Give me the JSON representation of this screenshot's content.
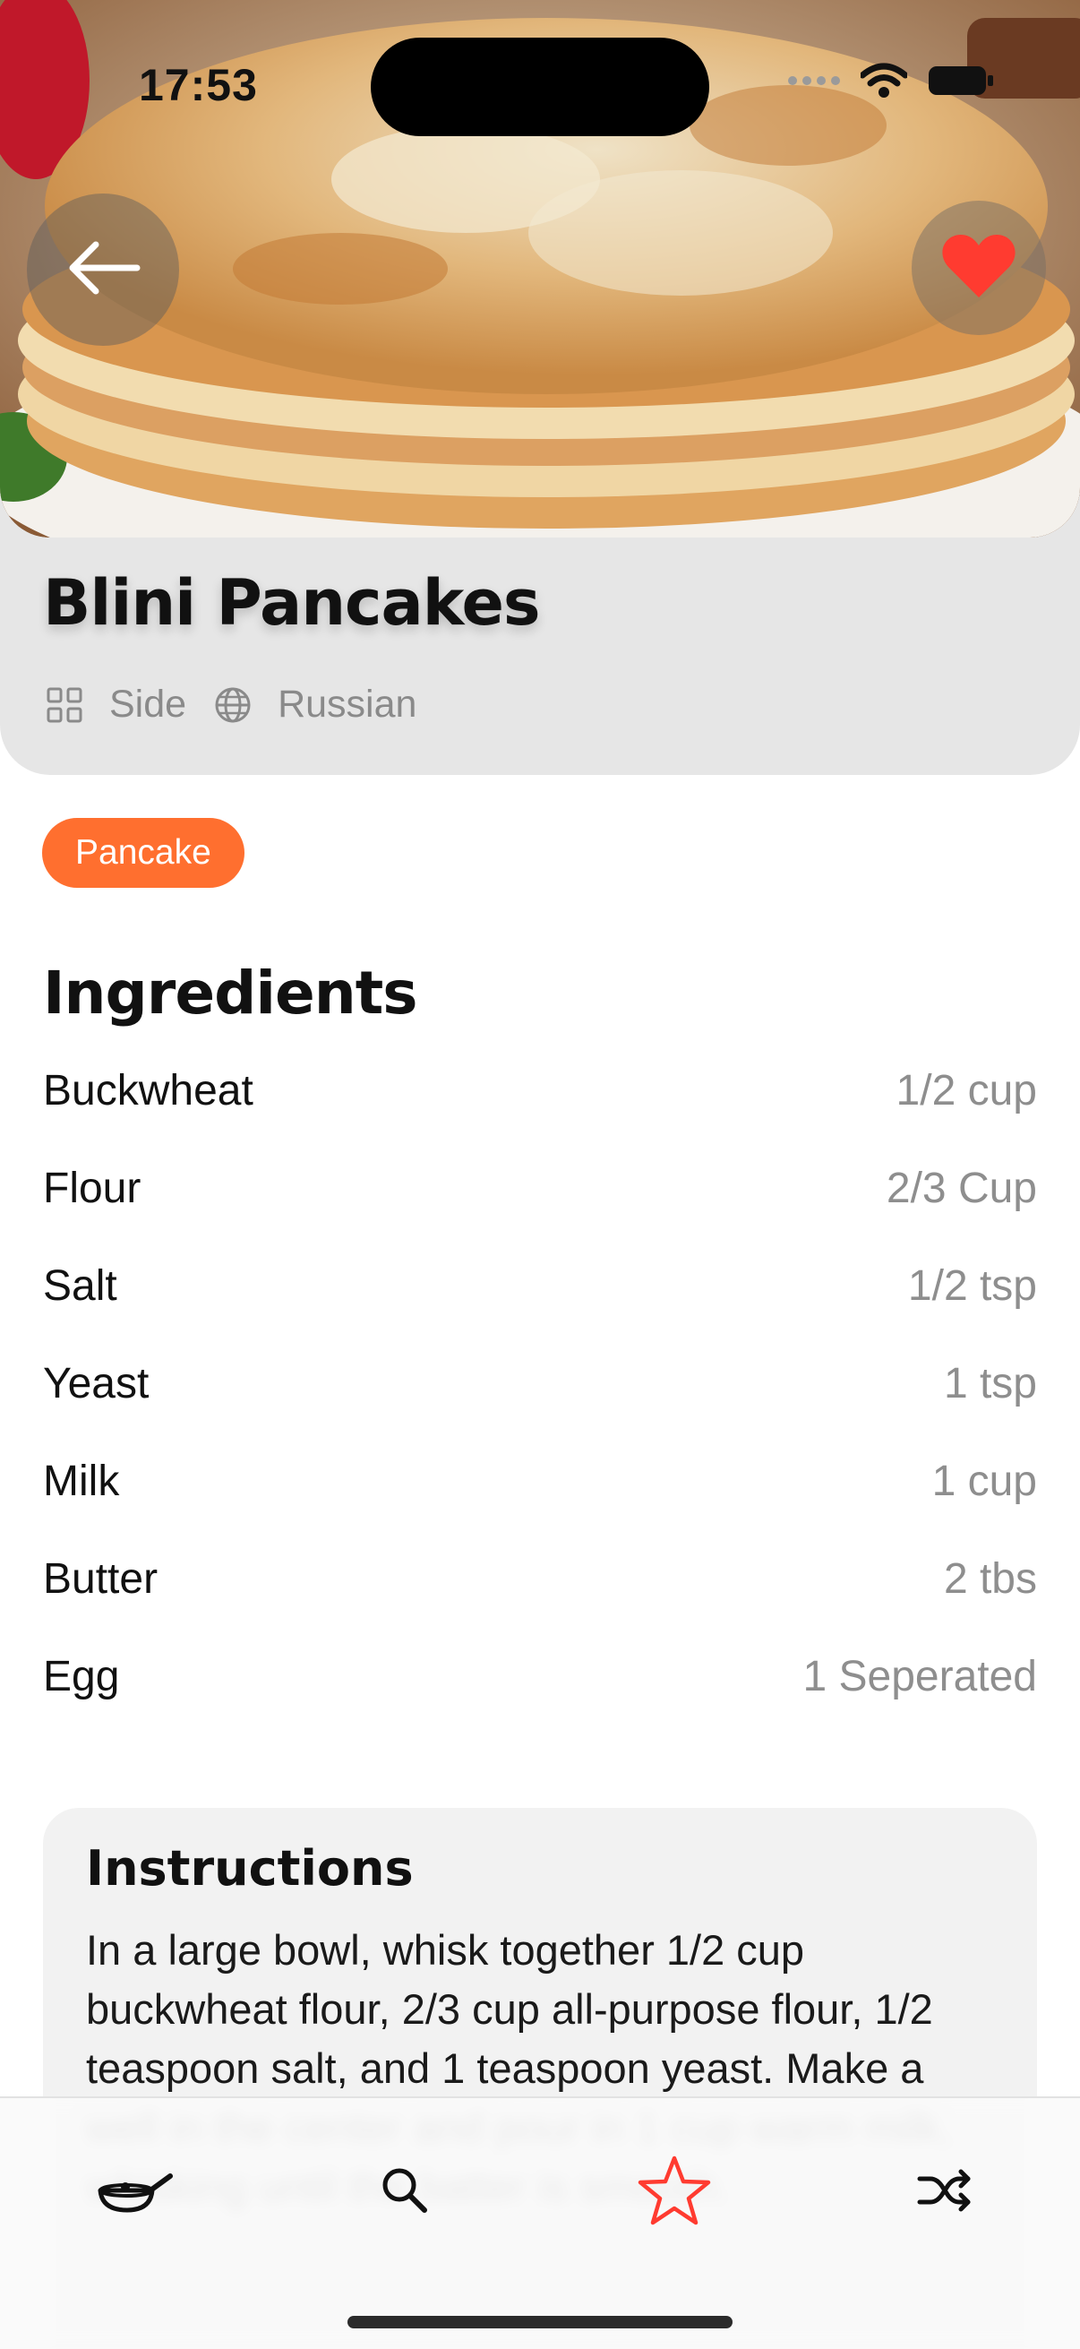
{
  "status_bar": {
    "time": "17:53"
  },
  "recipe": {
    "title": "Blini Pancakes",
    "category": "Side",
    "area": "Russian",
    "tags": [
      "Pancake"
    ]
  },
  "ingredients": {
    "heading": "Ingredients",
    "items": [
      {
        "name": "Buckwheat",
        "qty": "1/2 cup"
      },
      {
        "name": "Flour",
        "qty": "2/3 Cup"
      },
      {
        "name": "Salt",
        "qty": "1/2 tsp"
      },
      {
        "name": "Yeast",
        "qty": "1 tsp"
      },
      {
        "name": "Milk",
        "qty": "1 cup"
      },
      {
        "name": "Butter",
        "qty": "2 tbs"
      },
      {
        "name": "Egg",
        "qty": "1 Seperated"
      }
    ]
  },
  "instructions": {
    "heading": "Instructions",
    "text": "In a large bowl, whisk together 1/2 cup buckwheat flour, 2/3 cup all-purpose flour, 1/2 teaspoon salt, and 1 teaspoon yeast. Make a well in the center and pour in 1 cup warm milk, whisking until the batter is smooth."
  },
  "tabbar": {
    "items": [
      {
        "icon": "frying-pan-icon",
        "active": false
      },
      {
        "icon": "search-icon",
        "active": false
      },
      {
        "icon": "star-icon",
        "active": true
      },
      {
        "icon": "shuffle-icon",
        "active": false
      }
    ]
  },
  "colors": {
    "accent": "#ff6f2f",
    "favorite": "#ff3b30",
    "active_tab": "#ff3b30"
  }
}
